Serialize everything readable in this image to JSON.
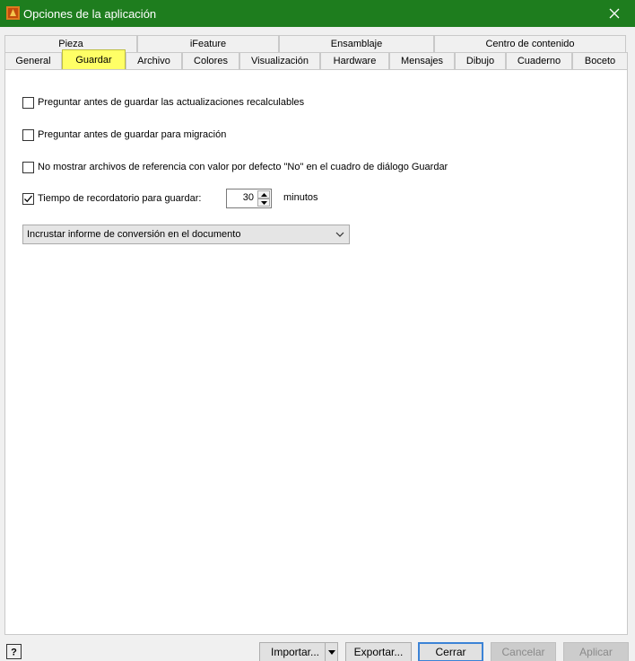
{
  "window": {
    "title": "Opciones de la aplicación"
  },
  "tabs_top": [
    {
      "label": "Pieza"
    },
    {
      "label": "iFeature"
    },
    {
      "label": "Ensamblaje"
    },
    {
      "label": "Centro de contenido"
    }
  ],
  "tabs_bottom": [
    {
      "label": "General"
    },
    {
      "label": "Guardar",
      "active": true
    },
    {
      "label": "Archivo"
    },
    {
      "label": "Colores"
    },
    {
      "label": "Visualización"
    },
    {
      "label": "Hardware"
    },
    {
      "label": "Mensajes"
    },
    {
      "label": "Dibujo"
    },
    {
      "label": "Cuaderno"
    },
    {
      "label": "Boceto"
    }
  ],
  "options": [
    {
      "label": "Preguntar antes de guardar las actualizaciones recalculables",
      "checked": false
    },
    {
      "label": "Preguntar antes de guardar para migración",
      "checked": false
    },
    {
      "label": "No mostrar archivos de referencia con valor por defecto \"No\" en el cuadro de diálogo Guardar",
      "checked": false
    },
    {
      "label": "Tiempo de recordatorio para guardar:",
      "checked": true
    }
  ],
  "reminder": {
    "value": "30",
    "unit": "minutos"
  },
  "dropdown": {
    "selected": "Incrustar informe de conversión en el documento"
  },
  "buttons": {
    "import": "Importar...",
    "export": "Exportar...",
    "close": "Cerrar",
    "cancel": "Cancelar",
    "apply": "Aplicar"
  },
  "colors": {
    "titlebar": "#1e7d1e",
    "active_tab": "#ffff66"
  }
}
